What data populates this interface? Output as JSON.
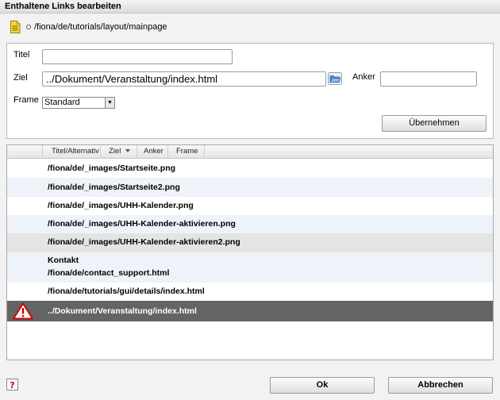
{
  "window": {
    "title": "Enthaltene Links bearbeiten"
  },
  "page": {
    "path": "/fiona/de/tutorials/layout/mainpage"
  },
  "form": {
    "titel_label": "Titel",
    "titel_value": "",
    "ziel_label": "Ziel",
    "ziel_value": "../Dokument/Veranstaltung/index.html",
    "anker_label": "Anker",
    "anker_value": "",
    "frame_label": "Frame",
    "frame_value": "Standard",
    "apply_label": "Übernehmen"
  },
  "grid": {
    "columns": [
      "Titel/Alternativ",
      "Ziel",
      "Anker",
      "Frame"
    ],
    "rows": [
      {
        "title": "",
        "target": "/fiona/de/_images/Startseite.png"
      },
      {
        "title": "",
        "target": "/fiona/de/_images/Startseite2.png"
      },
      {
        "title": "",
        "target": "/fiona/de/_images/UHH-Kalender.png"
      },
      {
        "title": "",
        "target": "/fiona/de/_images/UHH-Kalender-aktivieren.png"
      },
      {
        "title": "",
        "target": "/fiona/de/_images/UHH-Kalender-aktivieren2.png"
      },
      {
        "title": "Kontakt",
        "target": "/fiona/de/contact_support.html"
      },
      {
        "title": "",
        "target": "/fiona/de/tutorials/gui/details/index.html"
      },
      {
        "title": "",
        "target": "../Dokument/Veranstaltung/index.html",
        "selected": true,
        "warning": true
      }
    ]
  },
  "footer": {
    "ok_label": "Ok",
    "cancel_label": "Abbrechen"
  },
  "colors": {
    "selected_row": "#646464",
    "alt_row": "#eef3f9",
    "hover_row": "#e4e4e4",
    "warning": "#cc0000"
  }
}
